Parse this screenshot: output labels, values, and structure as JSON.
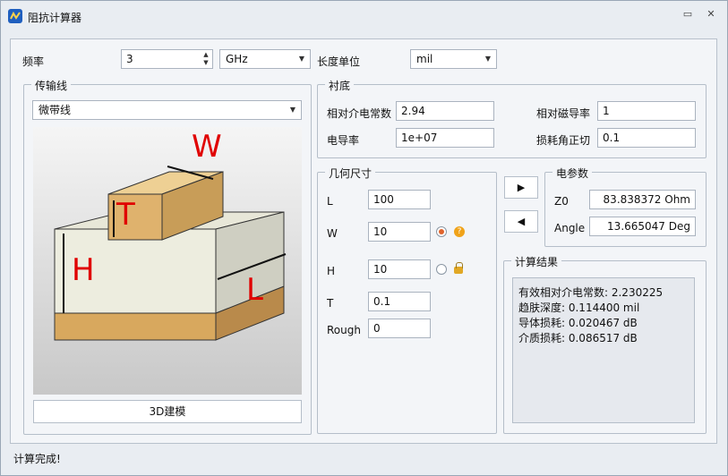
{
  "window": {
    "title": "阻抗计算器"
  },
  "frequency": {
    "label": "频率",
    "value": "3",
    "unit": "GHz"
  },
  "length_unit": {
    "label": "长度单位",
    "value": "mil"
  },
  "transmission_line": {
    "group_title": "传输线",
    "type": "微带线",
    "diagram_labels": {
      "w": "W",
      "t": "T",
      "h": "H",
      "l": "L"
    },
    "model_button": "3D建模"
  },
  "substrate": {
    "group_title": "衬底",
    "rel_permittivity_label": "相对介电常数",
    "rel_permittivity": "2.94",
    "rel_permeability_label": "相对磁导率",
    "rel_permeability": "1",
    "conductivity_label": "电导率",
    "conductivity": "1e+07",
    "loss_tangent_label": "损耗角正切",
    "loss_tangent": "0.1"
  },
  "geometry": {
    "group_title": "几何尺寸",
    "l_label": "L",
    "l_value": "100",
    "w_label": "W",
    "w_value": "10",
    "h_label": "H",
    "h_value": "10",
    "t_label": "T",
    "t_value": "0.1",
    "rough_label": "Rough",
    "rough_value": "0"
  },
  "controls": {
    "forward_icon": "▶",
    "backward_icon": "◀"
  },
  "electrical": {
    "group_title": "电参数",
    "z0_label": "Z0",
    "z0_value": "83.838372  Ohm",
    "angle_label": "Angle",
    "angle_value": "13.665047  Deg"
  },
  "results": {
    "group_title": "计算结果",
    "lines": [
      "有效相对介电常数: 2.230225",
      "趋肤深度: 0.114400 mil",
      "导体损耗: 0.020467 dB",
      "介质损耗: 0.086517 dB"
    ]
  },
  "status": "计算完成!"
}
